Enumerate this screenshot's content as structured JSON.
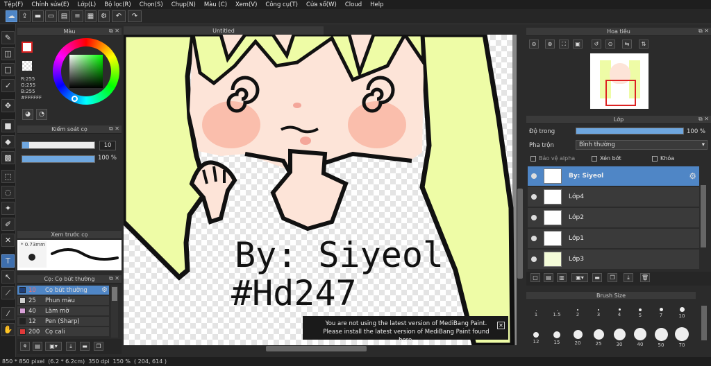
{
  "menu": [
    "Tệp(F)",
    "Chỉnh sửa(E)",
    "Lớp(L)",
    "Bộ lọc(R)",
    "Chọn(S)",
    "Chụp(N)",
    "Màu (C)",
    "Xem(V)",
    "Công cụ(T)",
    "Cửa sổ(W)",
    "Cloud",
    "Help"
  ],
  "color_panel": {
    "title": "Màu",
    "r": "R:255",
    "g": "G:255",
    "b": "B:255",
    "hex": "#FFFFFF"
  },
  "brush_control": {
    "title": "Kiểm soát cọ",
    "size": "10",
    "opacity": "100 %",
    "size_level": 0.1,
    "opacity_level": 1.0
  },
  "preview": {
    "title": "Xem trước cọ",
    "size": "* 0.73mm"
  },
  "brushes": {
    "title": "Cọ: Cọ bút thường",
    "items": [
      {
        "size": "10",
        "name": "Cọ bút thường",
        "color": "#1e3f7a"
      },
      {
        "size": "25",
        "name": "Phun màu",
        "color": "#cfcfcf"
      },
      {
        "size": "40",
        "name": "Làm mờ",
        "color": "#d8a0d8"
      },
      {
        "size": "12",
        "name": "Pen (Sharp)",
        "color": "#222222"
      },
      {
        "size": "200",
        "name": "Cọ cali",
        "color": "#e03a3a"
      }
    ]
  },
  "canvas": {
    "tab": "Untitled",
    "line1": "By: Siyeol",
    "line2": "#Hd247"
  },
  "notice": {
    "line1": "You are not using the latest version of MediBang Paint.",
    "line2": "Please install the latest version of MediBang Paint found here."
  },
  "navigator": {
    "title": "Hoa tiêu"
  },
  "layers": {
    "title": "Lớp",
    "opacity_label": "Độ trong",
    "opacity_value": "100 %",
    "opacity_level": 1.0,
    "blend_label": "Pha trộn",
    "blend_value": "Bình thường",
    "alpha_label": "Bảo vệ alpha",
    "clip_label": "Xén bớt",
    "lock_label": "Khóa",
    "items": [
      {
        "name": "By: Siyeol",
        "selected": true
      },
      {
        "name": "Lớp4",
        "selected": false
      },
      {
        "name": "Lớp2",
        "selected": false
      },
      {
        "name": "Lớp1",
        "selected": false
      },
      {
        "name": "Lớp3",
        "selected": false
      }
    ]
  },
  "brush_size": {
    "title": "Brush Size",
    "sizes": [
      "1",
      "1.5",
      "2",
      "3",
      "4",
      "5",
      "7",
      "10",
      "12",
      "15",
      "20",
      "25",
      "30",
      "40",
      "50",
      "70"
    ]
  },
  "status": {
    "text": "850 * 850 pixel  (6.2 * 6.2cm)  350 dpi  150 %  ( 204, 614 )"
  }
}
